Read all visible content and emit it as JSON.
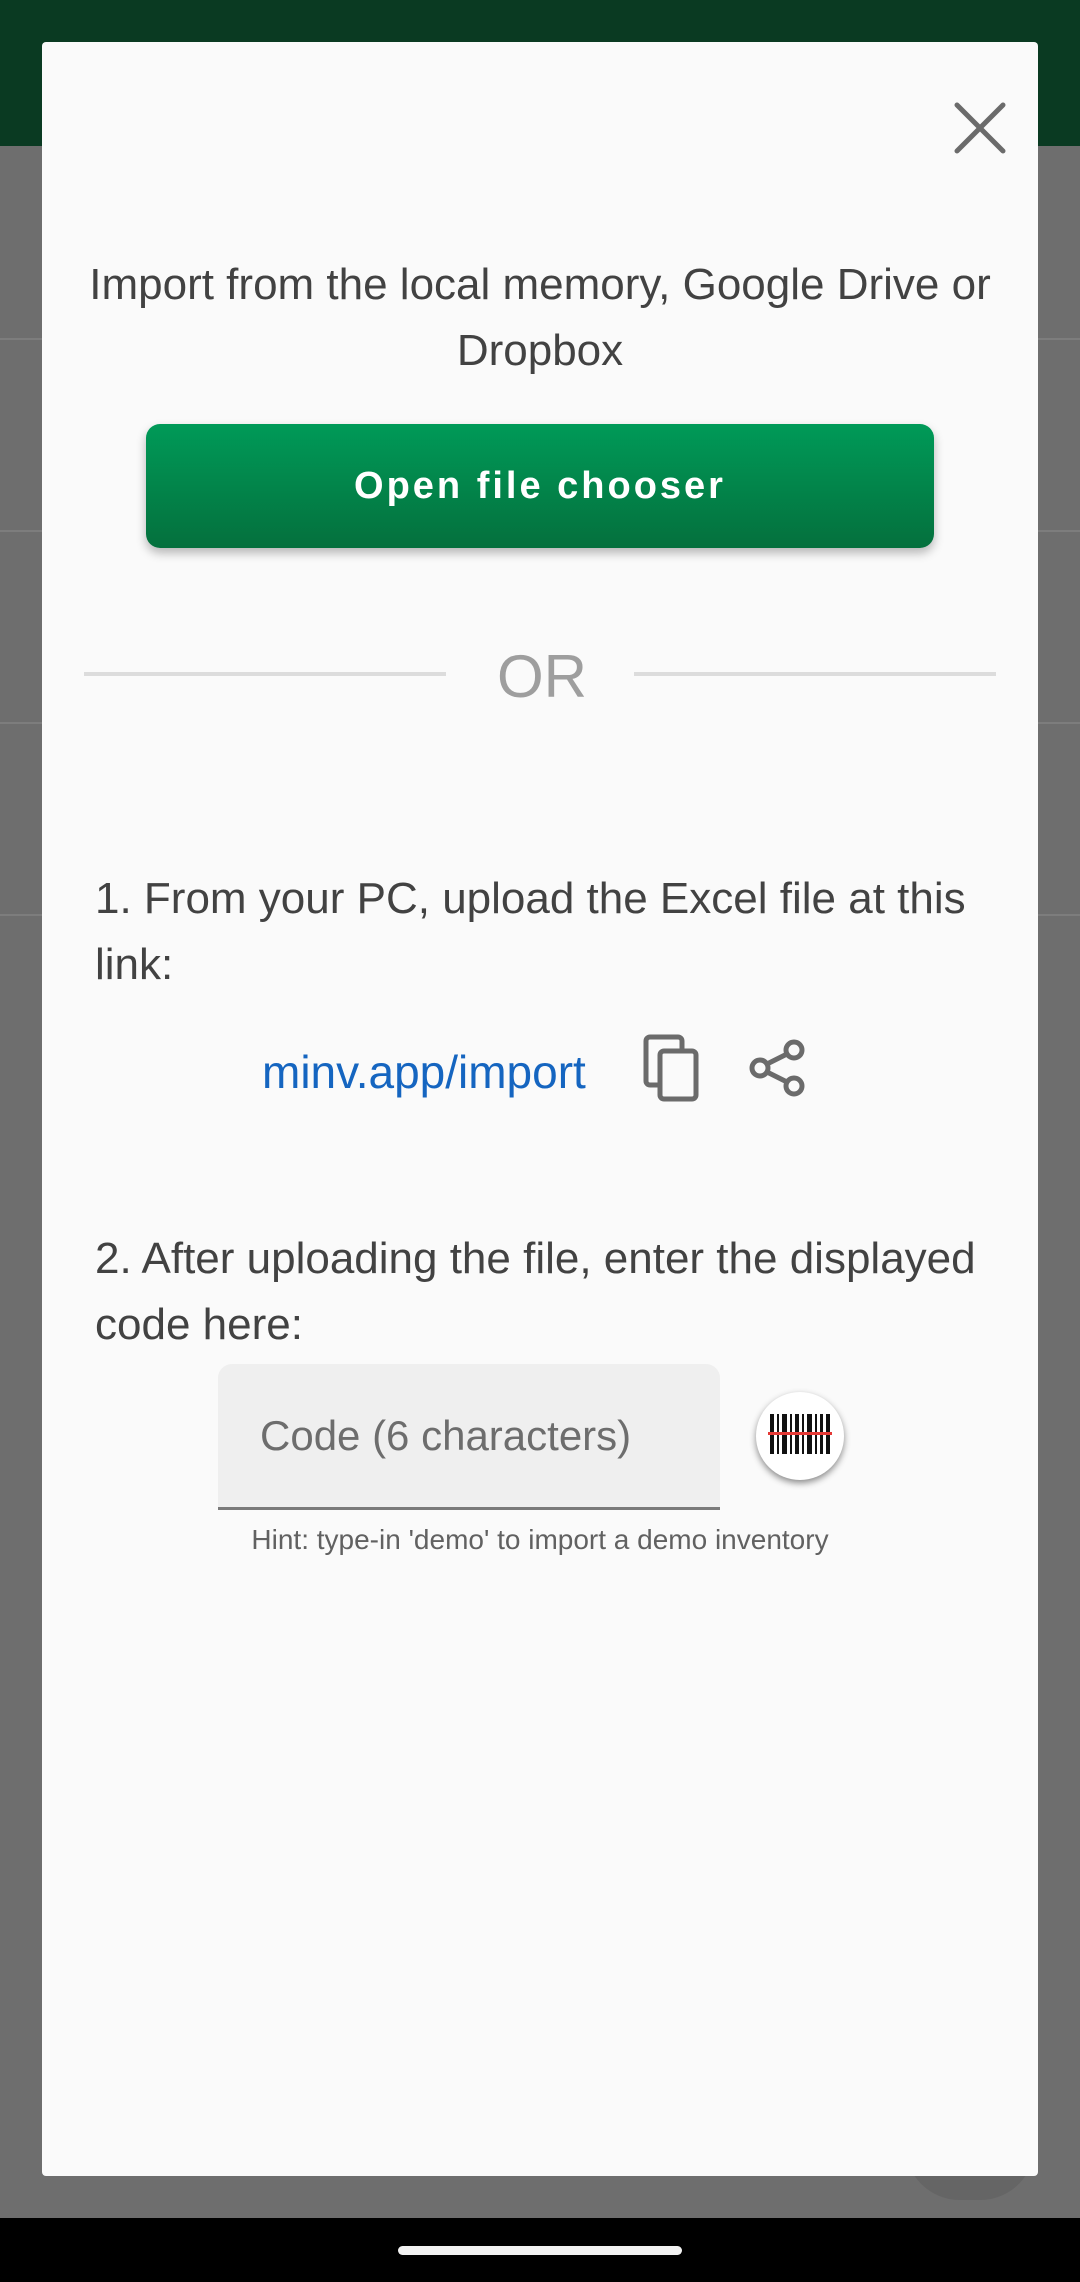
{
  "dialog": {
    "intro_text": "Import from the local memory, Google Drive or Dropbox",
    "open_button_label": "Open file chooser",
    "or_label": "OR",
    "step1_text": "1. From your PC, upload the Excel file at this link:",
    "link_text": "minv.app/import",
    "step2_text": "2. After uploading the file, enter the displayed code here:",
    "code_placeholder": "Code (6 characters)",
    "hint_text": "Hint: type-in 'demo' to import a demo inventory"
  },
  "icons": {
    "close": "close-icon",
    "copy": "copy-icon",
    "share": "share-icon",
    "scan": "barcode-scan-icon"
  },
  "colors": {
    "primary_green": "#04703d",
    "link_blue": "#1565c0",
    "appbar_dark_green": "#0a3a22"
  }
}
